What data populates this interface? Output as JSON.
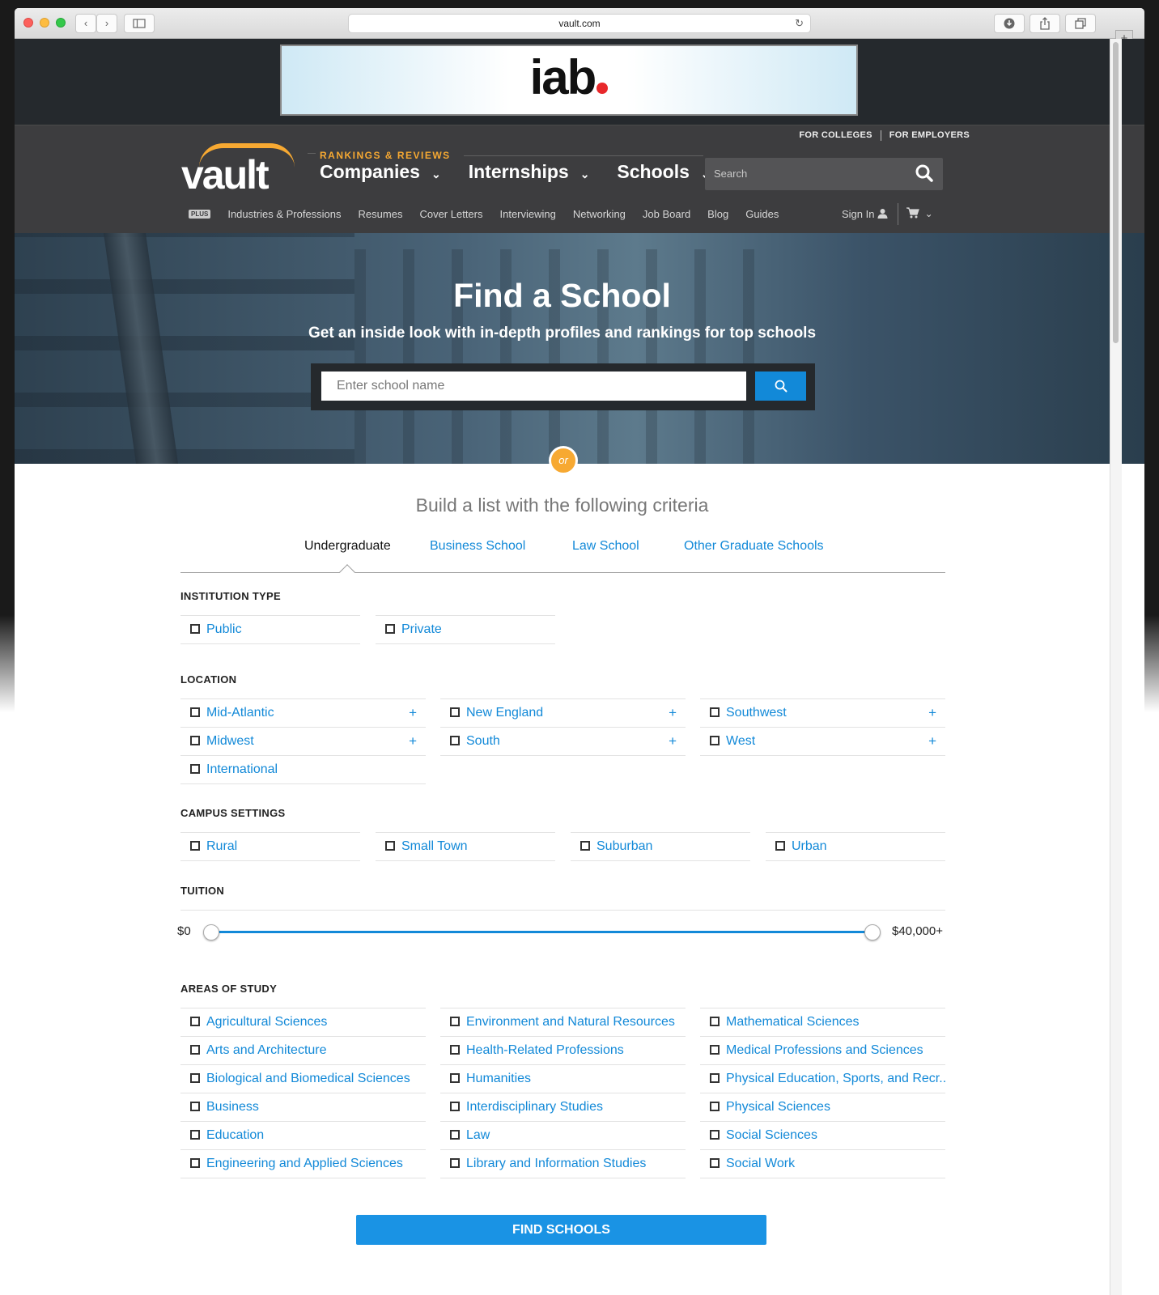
{
  "browser": {
    "url": "vault.com",
    "back_icon": "‹",
    "forward_icon": "›",
    "new_tab_icon": "+"
  },
  "ad": {
    "logo_text": "iab"
  },
  "header": {
    "top_links": [
      "FOR COLLEGES",
      "FOR EMPLOYERS"
    ],
    "logo": "vault",
    "rankings_label": "RANKINGS & REVIEWS",
    "main_nav": [
      "Companies",
      "Internships",
      "Schools"
    ],
    "search_placeholder": "Search",
    "plus_badge": "PLUS",
    "sub_nav": [
      "Industries & Professions",
      "Resumes",
      "Cover Letters",
      "Interviewing",
      "Networking",
      "Job Board",
      "Blog",
      "Guides"
    ],
    "sign_in": "Sign In"
  },
  "hero": {
    "title": "Find a School",
    "subtitle": "Get an inside look with in-depth profiles and rankings for top schools",
    "search_placeholder": "Enter school name",
    "or_label": "or"
  },
  "criteria": {
    "title": "Build a list with the following criteria",
    "tabs": [
      "Undergraduate",
      "Business School",
      "Law School",
      "Other Graduate Schools"
    ],
    "active_tab": "Undergraduate",
    "institution_type": {
      "heading": "INSTITUTION TYPE",
      "options": [
        "Public",
        "Private"
      ]
    },
    "location": {
      "heading": "LOCATION",
      "options": [
        "Mid-Atlantic",
        "New England",
        "Southwest",
        "Midwest",
        "South",
        "West",
        "International"
      ]
    },
    "campus_settings": {
      "heading": "CAMPUS SETTINGS",
      "options": [
        "Rural",
        "Small Town",
        "Suburban",
        "Urban"
      ]
    },
    "tuition": {
      "heading": "TUITION",
      "min_label": "$0",
      "max_label": "$40,000+",
      "range_fraction": [
        0,
        1
      ]
    },
    "areas_of_study": {
      "heading": "AREAS OF STUDY",
      "options": [
        "Agricultural Sciences",
        "Environment and Natural Resources",
        "Mathematical Sciences",
        "Arts and Architecture",
        "Health-Related Professions",
        "Medical Professions and Sciences",
        "Biological and Biomedical Sciences",
        "Humanities",
        "Physical Education, Sports, and Recr...",
        "Business",
        "Interdisciplinary Studies",
        "Physical Sciences",
        "Education",
        "Law",
        "Social Sciences",
        "Engineering and Applied Sciences",
        "Library and Information Studies",
        "Social Work"
      ]
    },
    "submit_label": "FIND SCHOOLS"
  },
  "colors": {
    "accent": "#1289d8",
    "brand_orange": "#f7a932",
    "header_bg": "#3d3d3f"
  }
}
